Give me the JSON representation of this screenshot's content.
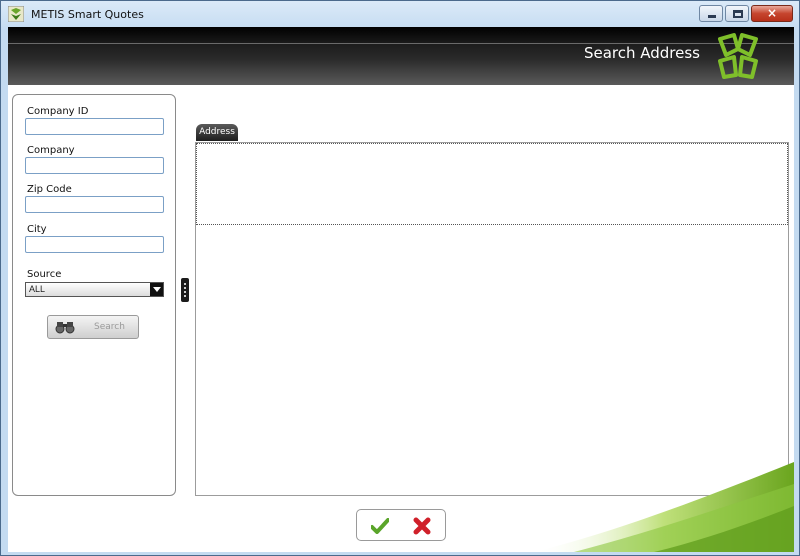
{
  "window": {
    "title": "METIS Smart Quotes",
    "icon": "metis-app-icon",
    "controls": {
      "minimize": "minimize-icon",
      "maximize": "maximize-icon",
      "close": "×"
    }
  },
  "banner": {
    "title": "Search Address",
    "logo": "metis-logo",
    "colors": {
      "accent_green": "#7fbf2a",
      "banner_dark": "#1a1a1a"
    }
  },
  "search_form": {
    "company_id": {
      "label": "Company ID",
      "value": "",
      "placeholder": ""
    },
    "company": {
      "label": "Company",
      "value": "",
      "placeholder": ""
    },
    "zip_code": {
      "label": "Zip Code",
      "value": "",
      "placeholder": ""
    },
    "city": {
      "label": "City",
      "value": "",
      "placeholder": ""
    },
    "source": {
      "label": "Source",
      "selected": "ALL"
    },
    "search_button": {
      "label": "Search",
      "icon": "binoculars-icon",
      "enabled": false
    }
  },
  "results": {
    "tabs": [
      {
        "label": "Address",
        "active": true
      }
    ],
    "rows": []
  },
  "actions": {
    "ok": {
      "icon": "checkmark-icon",
      "color": "#5aa52a"
    },
    "cancel": {
      "icon": "x-icon",
      "color": "#d0202a"
    }
  }
}
